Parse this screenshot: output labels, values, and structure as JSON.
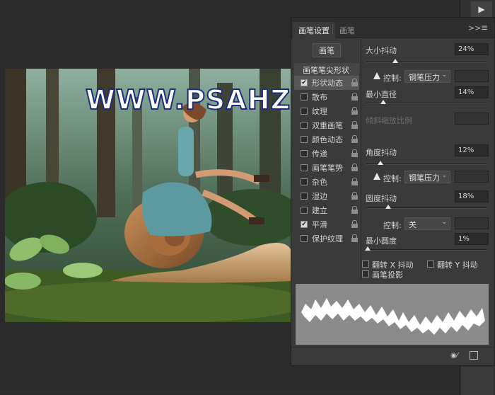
{
  "canvas": {
    "watermark": "WWW.PSAHZ.C"
  },
  "panel": {
    "tabs": [
      "画笔设置",
      "画笔"
    ],
    "menu_glyph": ">>",
    "brush_button": "画笔",
    "tip_header": "画笔笔尖形状",
    "options": [
      {
        "label": "形状动态",
        "checked": true
      },
      {
        "label": "散布",
        "checked": false
      },
      {
        "label": "纹理",
        "checked": false
      },
      {
        "label": "双重画笔",
        "checked": false
      },
      {
        "label": "颜色动态",
        "checked": false
      },
      {
        "label": "传递",
        "checked": false
      },
      {
        "label": "画笔笔势",
        "checked": false
      },
      {
        "label": "杂色",
        "checked": false
      },
      {
        "label": "湿边",
        "checked": false
      },
      {
        "label": "建立",
        "checked": false
      },
      {
        "label": "平滑",
        "checked": true
      },
      {
        "label": "保护纹理",
        "checked": false
      }
    ],
    "size_jitter": {
      "label": "大小抖动",
      "value": "24%",
      "fraction": 0.24
    },
    "control1": {
      "label": "控制:",
      "value": "钢笔压力"
    },
    "min_diameter": {
      "label": "最小直径",
      "value": "14%",
      "fraction": 0.14
    },
    "tilt_scale": {
      "label": "倾斜缩放比例"
    },
    "angle_jitter": {
      "label": "角度抖动",
      "value": "12%",
      "fraction": 0.12
    },
    "control2": {
      "label": "控制:",
      "value": "钢笔压力"
    },
    "roundness_jitter": {
      "label": "圆度抖动",
      "value": "18%",
      "fraction": 0.18
    },
    "control3": {
      "label": "控制:",
      "value": "关"
    },
    "min_roundness": {
      "label": "最小圆度",
      "value": "1%",
      "fraction": 0.01
    },
    "flip_x": "翻转 X 抖动",
    "flip_y": "翻转 Y 抖动",
    "brush_projection": "画笔投影"
  }
}
